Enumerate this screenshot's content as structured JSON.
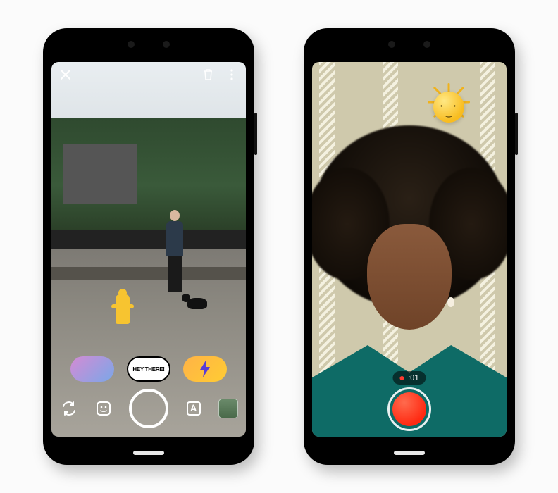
{
  "left_phone": {
    "top_bar": {
      "close_icon": "close",
      "delete_icon": "trash",
      "overflow_icon": "more"
    },
    "stickers": [
      {
        "name": "character-sticker"
      },
      {
        "name": "speech-bubble-sticker",
        "label": "HEY THERE!"
      },
      {
        "name": "lightning-sticker"
      }
    ],
    "bottom_bar": {
      "switch_camera_icon": "switch-camera",
      "sticker_picker_icon": "sticker",
      "shutter_label": "",
      "text_tool_label": "A",
      "gallery_thumb": "gallery"
    }
  },
  "right_phone": {
    "sticker": {
      "name": "sun-sticker"
    },
    "recording": {
      "indicator": "●",
      "elapsed": ":01"
    },
    "record_button": "record"
  }
}
